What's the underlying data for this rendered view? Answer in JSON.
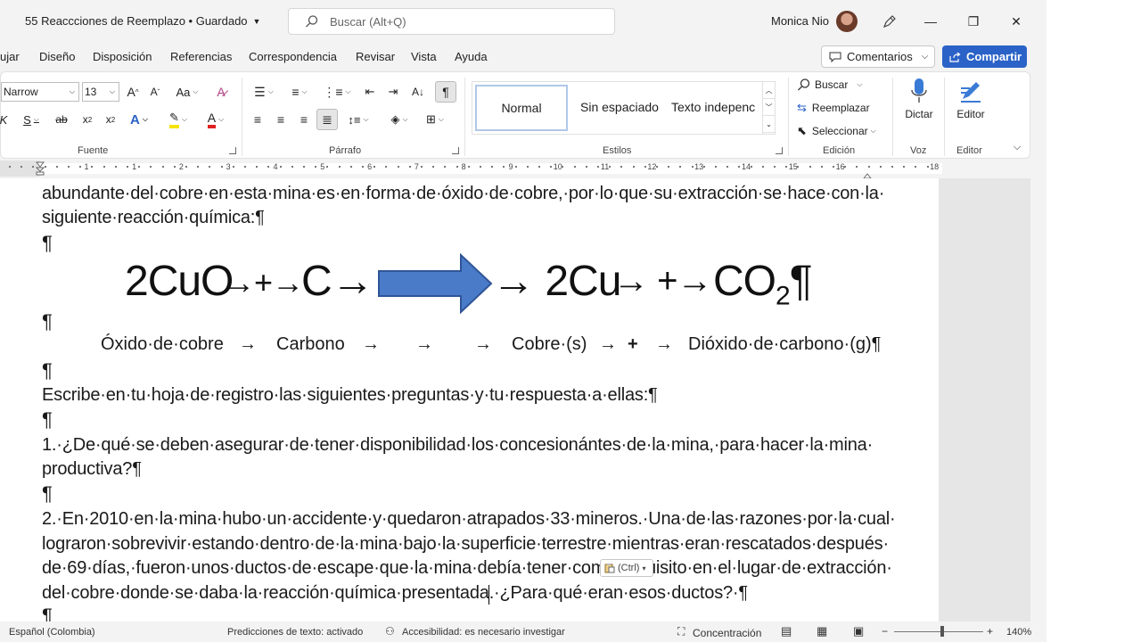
{
  "titlebar": {
    "doc_title": "55 Reaccciones de Reemplazo • Guardado",
    "search_placeholder": "Buscar (Alt+Q)",
    "user_name": "Monica Nio"
  },
  "menu": {
    "items": [
      "ujar",
      "Diseño",
      "Disposición",
      "Referencias",
      "Correspondencia",
      "Revisar",
      "Vista",
      "Ayuda"
    ],
    "comments_label": "Comentarios",
    "share_label": "Compartir"
  },
  "ribbon": {
    "font_name": "Narrow",
    "font_size": "13",
    "groups": {
      "font": "Fuente",
      "paragraph": "Párrafo",
      "styles": "Estilos",
      "editing": "Edición",
      "voice": "Voz",
      "editor": "Editor"
    },
    "styles": [
      "Normal",
      "Sin espaciado",
      "Texto indepenc"
    ],
    "editing": {
      "find": "Buscar",
      "replace": "Reemplazar",
      "select": "Seleccionar"
    },
    "dictate_label": "Dictar",
    "editor_label": "Editor"
  },
  "ruler": {
    "numbers": [
      "1",
      "2",
      "1",
      "2",
      "3",
      "4",
      "5",
      "6",
      "7",
      "8",
      "9",
      "10",
      "11",
      "12",
      "13",
      "14",
      "15",
      "16",
      "18"
    ]
  },
  "document": {
    "line1": "abundante·del·cobre·en·esta·mina·es·en·forma·de·óxido·de·cobre,·por·lo·que·su·extracción·se·hace·con·la·",
    "line2": "siguiente·reacción·química:¶",
    "pilcrow": "¶",
    "equation": {
      "reactant1": "2CuO",
      "op1": "→+→",
      "reactant2": "C→",
      "product1": "→ 2Cu",
      "op2": "→ +→",
      "product2": "CO",
      "product2_sub": "2",
      "end": "¶"
    },
    "labels": {
      "oxide": "Óxido·de·cobre",
      "arrow": "→",
      "carbon": "Carbono",
      "copper": "Cobre·(s)",
      "plus": "+",
      "dioxide": "Dióxido·de·carbono·(g)¶"
    },
    "line_write": "Escribe·en·tu·hoja·de·registro·las·siguientes·preguntas·y·tu·respuesta·a·ellas:¶",
    "q1_a": "1.·¿De·qué·se·deben·asegurar·de·tener·disponibilidad·los·concesionántes·de·la·mina,·para·hacer·la·mina·",
    "q1_b": "productiva?¶",
    "q2_a": "2.·En·2010·en·la·mina·hubo·un·accidente·y·quedaron·atrapados·33·mineros.·Una·de·las·razones·por·la·cual·",
    "q2_b": "lograron·sobrevivir·estando·dentro·de·la·mina·bajo·la·superficie·terrestre·mientras·eran·rescatados·después·",
    "q2_c": "de·69·días,·fueron·unos·ductos·de·escape·que·la·mina·debía·tener·como·requisito·en·el·lugar·de·extracción·",
    "q2_d": "del·cobre·donde·se·daba·la·reacción·química·presentada.·¿Para·qué·eran·esos·ductos?·¶",
    "ctrl_tag": "(Ctrl)"
  },
  "statusbar": {
    "language": "Español (Colombia)",
    "predictions": "Predicciones de texto: activado",
    "accessibility": "Accesibilidad: es necesario investigar",
    "focus": "Concentración",
    "zoom": "140%",
    "zoom_value": 140
  },
  "colors": {
    "accent": "#2b62c7",
    "arrow_fill": "#4a7bc8",
    "arrow_stroke": "#2f5597"
  }
}
